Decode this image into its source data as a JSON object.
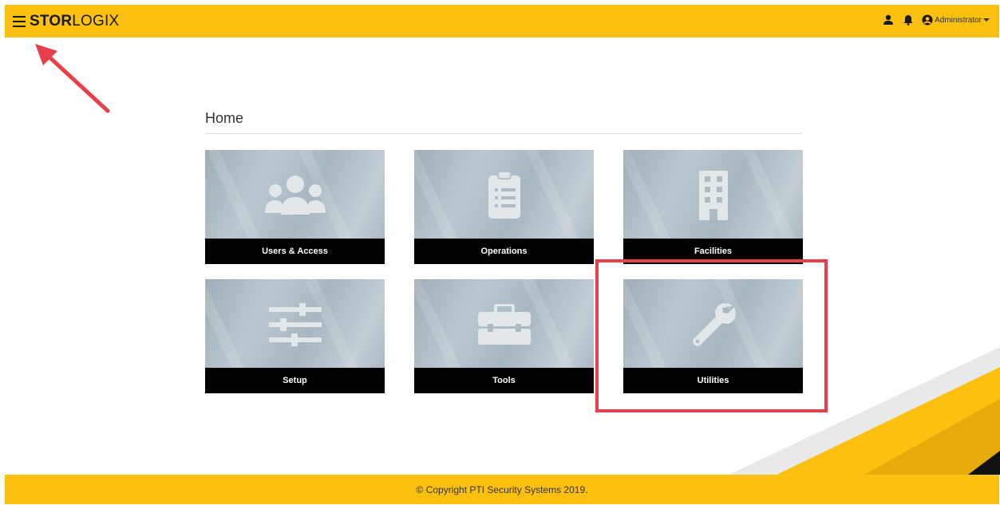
{
  "header": {
    "brand_bold": "STOR",
    "brand_rest": "LOGIX",
    "user_menu_label": "Administrator"
  },
  "page": {
    "title": "Home"
  },
  "tiles": [
    {
      "label": "Users & Access",
      "icon": "users-icon"
    },
    {
      "label": "Operations",
      "icon": "clipboard-list-icon"
    },
    {
      "label": "Facilities",
      "icon": "building-icon"
    },
    {
      "label": "Setup",
      "icon": "sliders-icon"
    },
    {
      "label": "Tools",
      "icon": "toolbox-icon"
    },
    {
      "label": "Utilities",
      "icon": "wrench-icon"
    }
  ],
  "footer": {
    "copyright": "© Copyright PTI Security Systems 2019."
  },
  "colors": {
    "brand_yellow": "#fcc010",
    "tile_label_bg": "#000000",
    "annotation_red": "#e8404a"
  }
}
